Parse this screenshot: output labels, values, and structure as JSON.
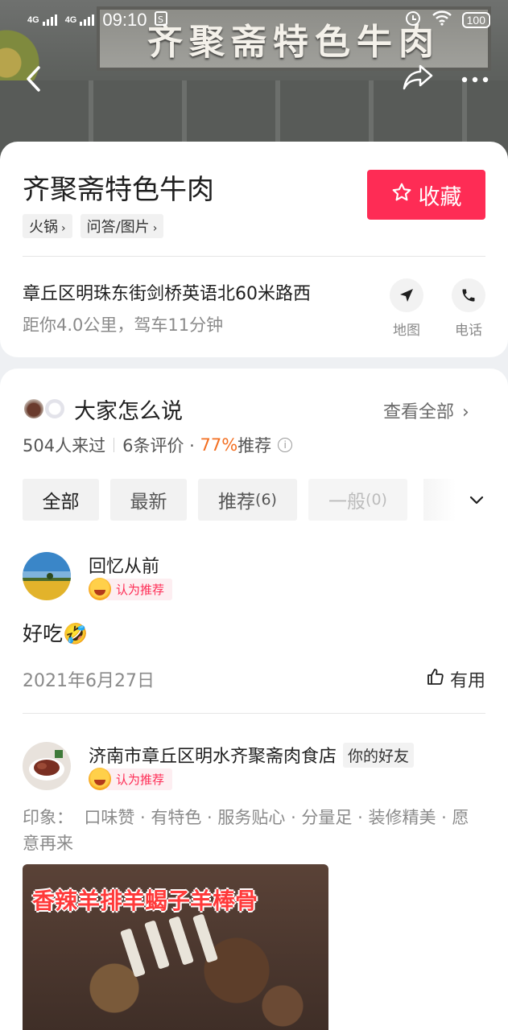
{
  "status_bar": {
    "network1": "4G",
    "network2": "4G",
    "time": "09:10",
    "battery": "100"
  },
  "hero": {
    "sign_text": "齐聚斋特色牛肉"
  },
  "shop": {
    "name": "齐聚斋特色牛肉",
    "tags": [
      {
        "label": "火锅"
      },
      {
        "label": "问答/图片"
      }
    ],
    "favorite_label": "收藏",
    "address": "章丘区明珠东街剑桥英语北60米路西",
    "distance": "距你4.0公里，驾车11分钟",
    "map_label": "地图",
    "phone_label": "电话"
  },
  "reviews": {
    "title": "大家怎么说",
    "view_all": "查看全部",
    "visited": "504人来过",
    "review_count": "6条评价 · ",
    "recommend_pct": "77%",
    "recommend_label": "推荐",
    "filters": [
      {
        "label": "全部",
        "count": ""
      },
      {
        "label": "最新",
        "count": ""
      },
      {
        "label": "推荐",
        "count": "(6)"
      },
      {
        "label": "一般",
        "count": "(0)"
      }
    ],
    "items": [
      {
        "user": "回忆从前",
        "badge": "认为推荐",
        "text": "好吃🤣",
        "date": "2021年6月27日",
        "useful": "有用"
      },
      {
        "user": "济南市章丘区明水齐聚斋肉食店",
        "friend_tag": "你的好友",
        "badge": "认为推荐",
        "impression": "印象：  口味赞 · 有特色 · 服务贴心 · 分量足 · 装修精美 · 愿意再来",
        "photo_caption": "香辣羊排羊蝎子羊棒骨"
      }
    ]
  },
  "colors": {
    "accent": "#fe2c55",
    "recommend": "#f36f21"
  }
}
